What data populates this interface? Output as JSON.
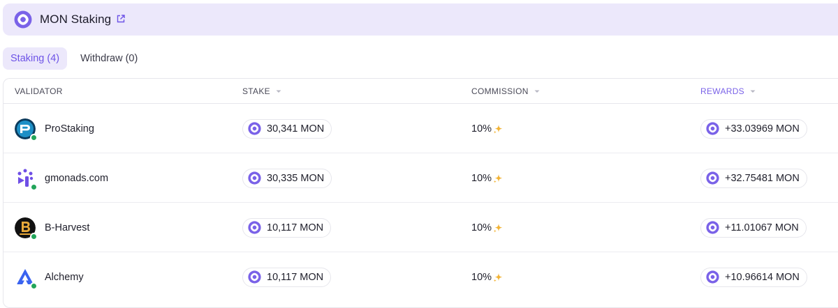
{
  "header": {
    "title": "MON Staking",
    "logo_icon": "mon-logo-icon",
    "link_icon": "external-link-icon"
  },
  "tabs": [
    {
      "label": "Staking (4)",
      "active": true
    },
    {
      "label": "Withdraw (0)",
      "active": false
    }
  ],
  "table": {
    "columns": [
      {
        "label": "VALIDATOR",
        "sortable": false
      },
      {
        "label": "STAKE",
        "sortable": true
      },
      {
        "label": "COMMISSION",
        "sortable": true
      },
      {
        "label": "REWARDS",
        "sortable": true,
        "active": true
      }
    ],
    "rows": [
      {
        "validator": "ProStaking",
        "avatar_icon": "prostaking-logo-icon",
        "stake": "30,341 MON",
        "commission": "10%",
        "rewards": "+33.03969 MON"
      },
      {
        "validator": "gmonads.com",
        "avatar_icon": "gmonads-logo-icon",
        "stake": "30,335 MON",
        "commission": "10%",
        "rewards": "+32.75481 MON"
      },
      {
        "validator": "B-Harvest",
        "avatar_icon": "bharvest-logo-icon",
        "stake": "10,117 MON",
        "commission": "10%",
        "rewards": "+11.01067 MON"
      },
      {
        "validator": "Alchemy",
        "avatar_icon": "alchemy-logo-icon",
        "stake": "10,117 MON",
        "commission": "10%",
        "rewards": "+10.96614 MON"
      }
    ]
  },
  "colors": {
    "accent": "#7a62e8",
    "tab_bg": "#ece8fb",
    "online": "#22a55a",
    "sparkle": "#f2b335"
  }
}
